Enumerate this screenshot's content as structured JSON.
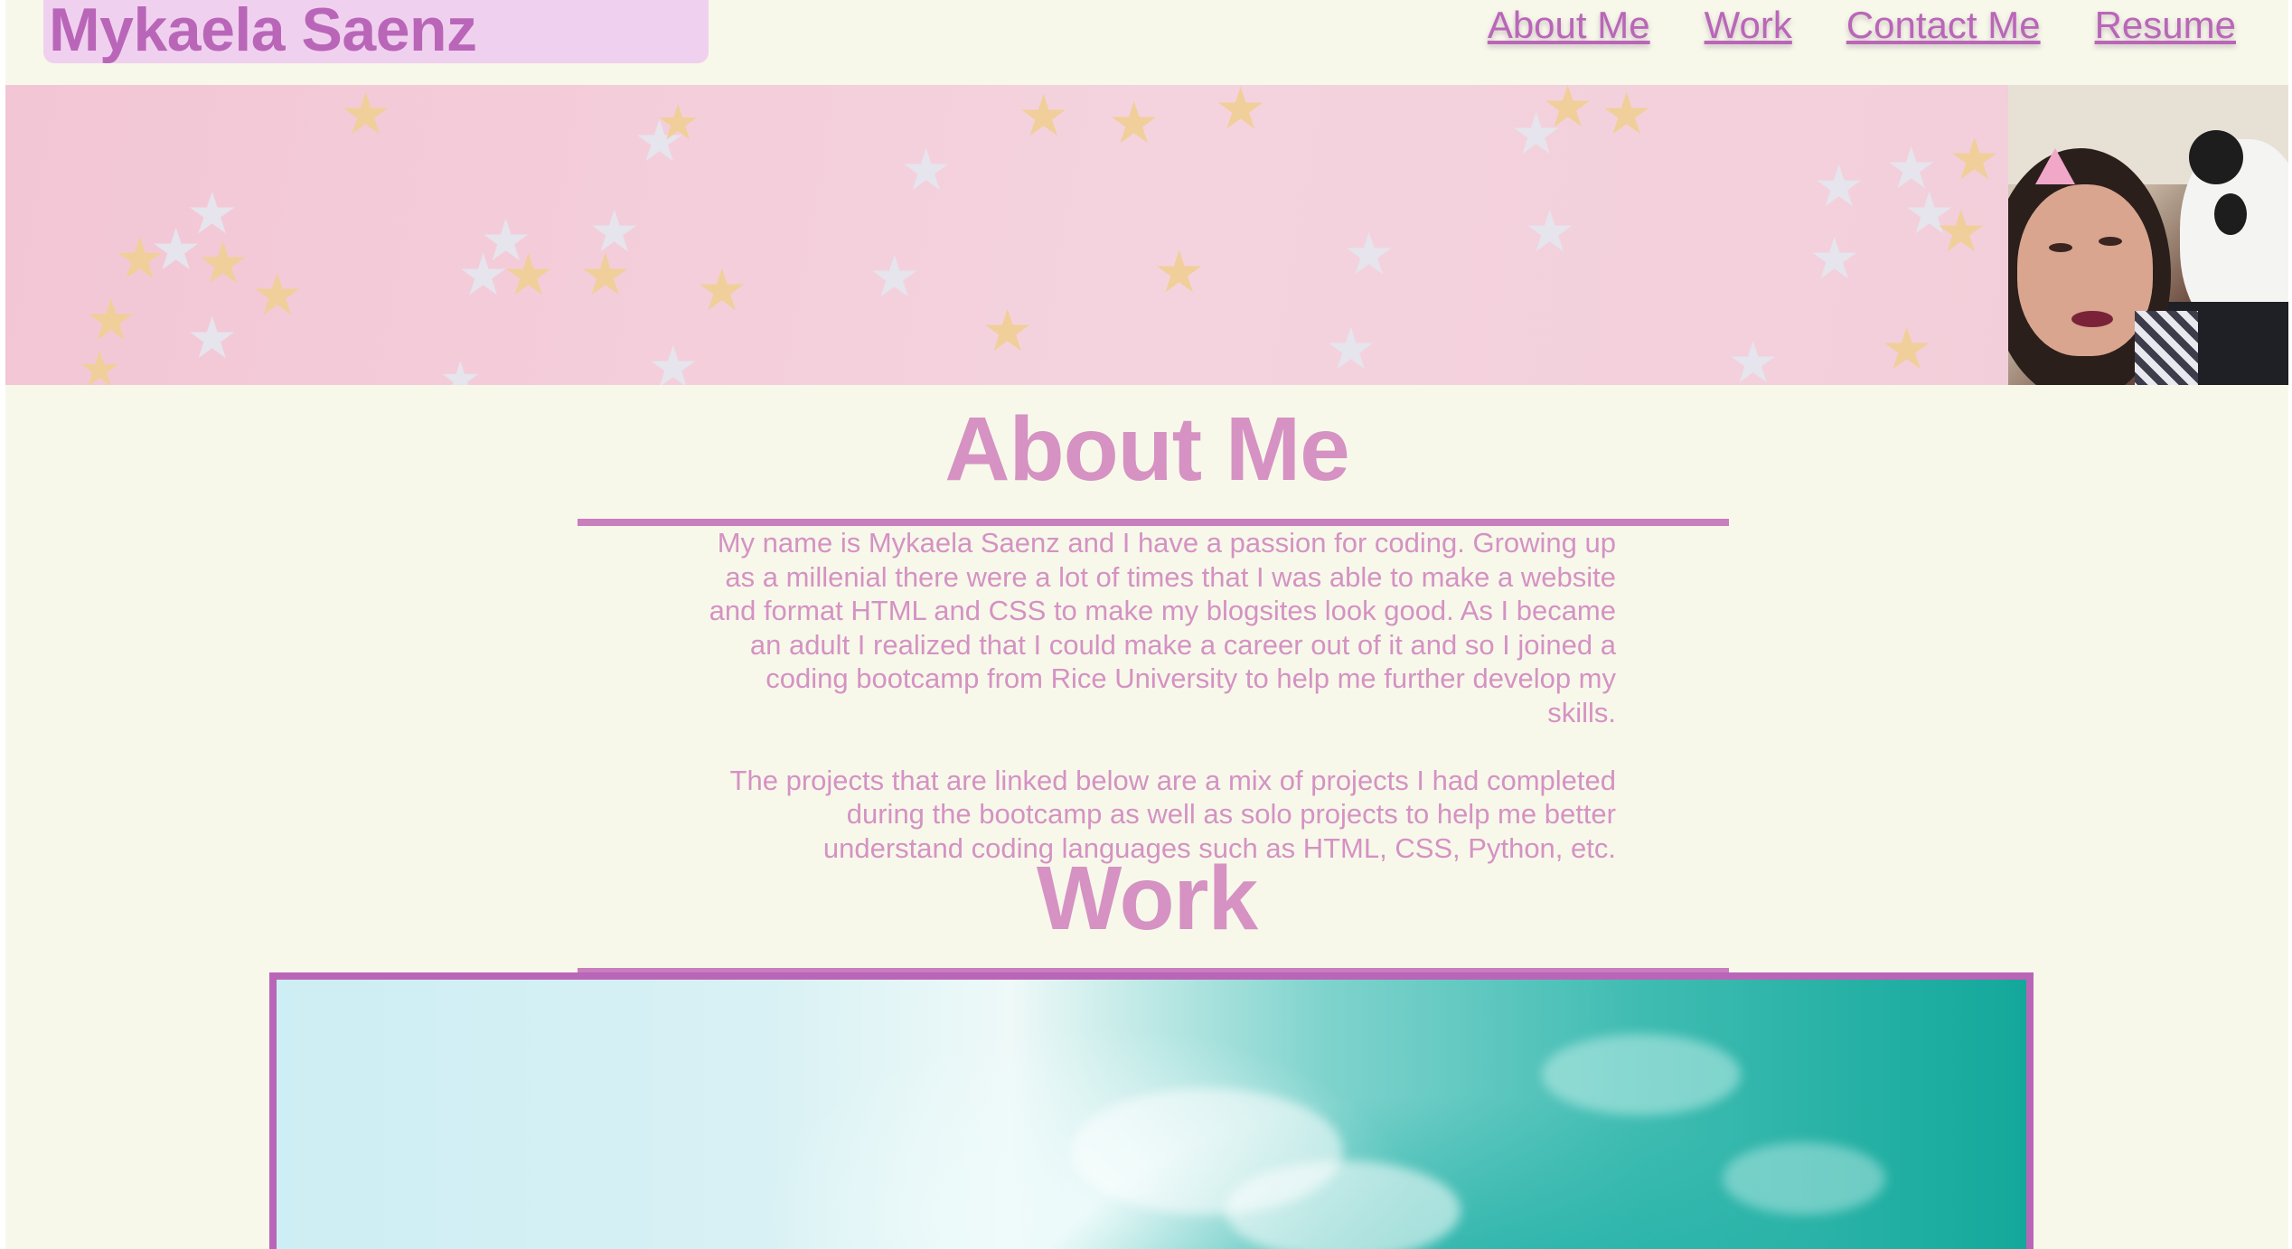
{
  "header": {
    "brand_name": "Mykaela Saenz",
    "nav": [
      {
        "label": "About Me"
      },
      {
        "label": "Work"
      },
      {
        "label": "Contact Me"
      },
      {
        "label": "Resume"
      }
    ]
  },
  "banner": {
    "background": "pink-with-stars",
    "portrait": "profile-photo"
  },
  "about": {
    "title": "About Me",
    "paragraphs": [
      "My name is Mykaela Saenz and I have a passion for coding. Growing up as a millenial there were a lot of times that I was able to make a website and format HTML and CSS to make my blogsites look good. As I became an adult I realized that I could make a career out of it and so I joined a coding bootcamp from Rice University to help me further develop my skills.",
      "The projects that are linked below are a mix of projects I had completed during the bootcamp as well as solo projects to help me better understand coding languages such as HTML, CSS, Python, etc."
    ]
  },
  "work": {
    "title": "Work",
    "featured_image": "ocean-wave"
  },
  "colors": {
    "accent": "#b966b8",
    "heading": "#d592c3",
    "page_background": "#f7f8ea",
    "brand_background": "#f0d0ef"
  }
}
